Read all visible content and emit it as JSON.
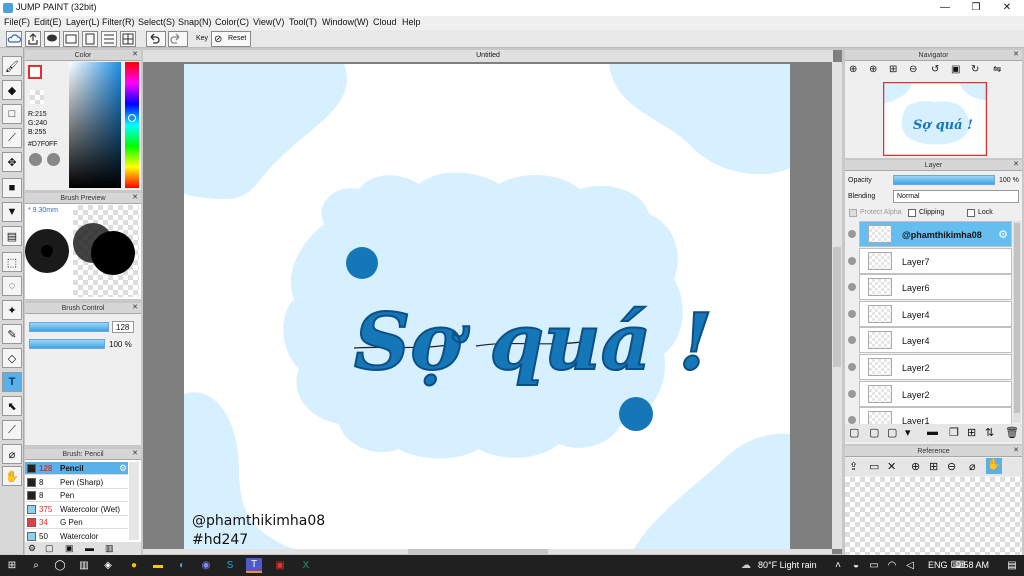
{
  "window": {
    "title": "JUMP PAINT (32bit)",
    "minimize": "—",
    "maximize": "❐",
    "close": "✕"
  },
  "menu": [
    "File(F)",
    "Edit(E)",
    "Layer(L)",
    "Filter(R)",
    "Select(S)",
    "Snap(N)",
    "Color(C)",
    "View(V)",
    "Tool(T)",
    "Window(W)",
    "Cloud",
    "Help"
  ],
  "toolbar": {
    "key_label": "Key",
    "reset_label": "Reset"
  },
  "color_panel": {
    "title": "Color",
    "r": "R:215",
    "g": "G:240",
    "b": "B:255",
    "hex": "#D7F0FF"
  },
  "brush_preview": {
    "title": "Brush Preview",
    "size": "* 9.30mm"
  },
  "brush_control": {
    "title": "Brush Control",
    "size_value": "128",
    "opacity_value": "100 %"
  },
  "brush_list": {
    "title": "Brush: Pencil",
    "items": [
      {
        "size": "128",
        "name": "Pencil",
        "swatch": "#222222",
        "size_color": "#e03030"
      },
      {
        "size": "8",
        "name": "Pen (Sharp)",
        "swatch": "#222222",
        "size_color": "#111111"
      },
      {
        "size": "8",
        "name": "Pen",
        "swatch": "#222222",
        "size_color": "#111111"
      },
      {
        "size": "375",
        "name": "Watercolor (Wet)",
        "swatch": "#8fd0f0",
        "size_color": "#e03030"
      },
      {
        "size": "34",
        "name": "G Pen",
        "swatch": "#e04040",
        "size_color": "#e03030"
      },
      {
        "size": "50",
        "name": "Watercolor",
        "swatch": "#8fd0f0",
        "size_color": "#111111"
      }
    ]
  },
  "document": {
    "tab_title": "Untitled"
  },
  "artwork": {
    "headline": "Sợ quá !",
    "credit_line1": "@phamthikimha08",
    "credit_line2": "#hd247",
    "bg_color": "#d7f0ff",
    "ink_color": "#1576b8"
  },
  "navigator": {
    "title": "Navigator"
  },
  "layer_panel": {
    "title": "Layer",
    "opacity_label": "Opacity",
    "opacity_value": "100 %",
    "blending_label": "Blending",
    "blending_value": "Normal",
    "protect_alpha": "Protect Alpha",
    "clipping": "Clipping",
    "lock": "Lock",
    "layers": [
      "@phamthikimha08",
      "Layer7",
      "Layer6",
      "Layer4",
      "Layer4",
      "Layer2",
      "Layer2",
      "Layer1"
    ]
  },
  "reference": {
    "title": "Reference"
  },
  "taskbar": {
    "weather": "80°F  Light rain",
    "lang": "ENG",
    "time": "9:58 AM"
  }
}
